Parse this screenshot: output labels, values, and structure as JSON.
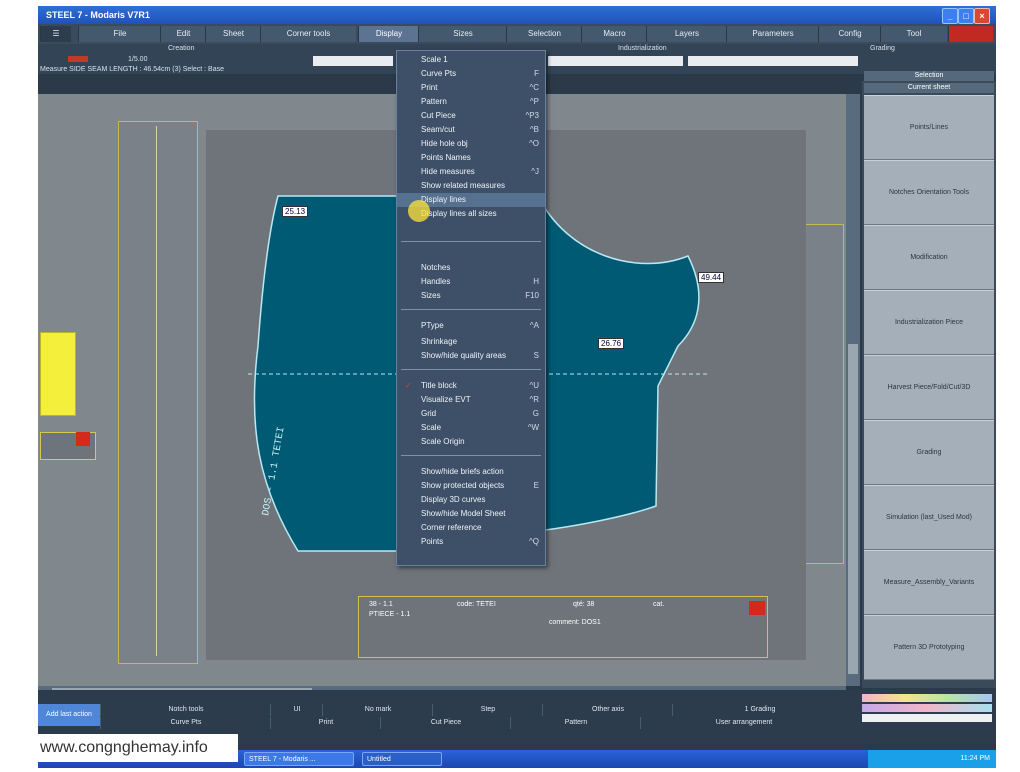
{
  "window": {
    "title": "STEEL 7 - Modaris V7R1",
    "title_short": "STEEL 7 -",
    "title_app": "Modaris V7R1"
  },
  "menubar": {
    "items": [
      "File",
      "Edit",
      "Sheet",
      "Corner tools",
      "Display",
      "Sizes",
      "Selection",
      "Macro",
      "Layers",
      "Parameters",
      "Config",
      "Tool"
    ],
    "active": "Display"
  },
  "toolbar": {
    "creation_label": "Creation",
    "indus_label": "Industrialization",
    "grading_label": "Grading",
    "scale_value": "1/5.00",
    "measure_text": "Measure SIDE SEAM LENGTH : 46.54cm (3)   Select : Base"
  },
  "display_menu": {
    "items": [
      {
        "label": "Scale 1",
        "shortcut": ""
      },
      {
        "label": "Curve Pts",
        "shortcut": "F"
      },
      {
        "label": "Print",
        "shortcut": "^C"
      },
      {
        "label": "Pattern",
        "shortcut": "^P"
      },
      {
        "label": "Cut Piece",
        "shortcut": "^P3"
      },
      {
        "label": "Seam/cut",
        "shortcut": "^B"
      },
      {
        "label": "Hide hole obj",
        "shortcut": "^O"
      },
      {
        "label": "Points Names",
        "shortcut": ""
      },
      {
        "label": "Hide measures",
        "shortcut": "^J"
      },
      {
        "label": "Show related measures",
        "shortcut": ""
      },
      {
        "label": "Display lines",
        "shortcut": ""
      },
      {
        "label": "Display lines all sizes",
        "shortcut": ""
      },
      {
        "label": "Notches",
        "shortcut": ""
      },
      {
        "label": "Handles",
        "shortcut": "H"
      },
      {
        "label": "Sizes",
        "shortcut": "F10"
      },
      {
        "label": "PType",
        "shortcut": "^A"
      },
      {
        "label": "Shrinkage",
        "shortcut": ""
      },
      {
        "label": "Show/hide quality areas",
        "shortcut": "S"
      },
      {
        "label": "Title block",
        "shortcut": "^U"
      },
      {
        "label": "Visualize EVT",
        "shortcut": "^R"
      },
      {
        "label": "Grid",
        "shortcut": "G"
      },
      {
        "label": "Scale",
        "shortcut": "^W"
      },
      {
        "label": "Scale Origin",
        "shortcut": ""
      },
      {
        "label": "Show/hide briefs action",
        "shortcut": ""
      },
      {
        "label": "Show protected objects",
        "shortcut": "E"
      },
      {
        "label": "Display 3D curves",
        "shortcut": ""
      },
      {
        "label": "Show/hide Model Sheet",
        "shortcut": ""
      },
      {
        "label": "Corner reference",
        "shortcut": ""
      },
      {
        "label": "Points",
        "shortcut": "^Q"
      }
    ]
  },
  "right_panel": {
    "selection_label": "Selection",
    "sheet_label": "Current sheet",
    "buttons": [
      "Points/Lines",
      "Notches Orientation Tools",
      "Modification",
      "Industrialization Piece",
      "Harvest Piece/Fold/Cut/3D",
      "Grading",
      "Simulation (last_Used Mod)",
      "Measure_Assembly_Variants",
      "Pattern 3D Prototyping"
    ]
  },
  "piece_labels": {
    "label1": "25.13",
    "label2": "49.44",
    "label3": "26.76",
    "label4": "38"
  },
  "title_block": {
    "line1": "38 - 1.1",
    "line2": "PTIECE - 1.1",
    "code": "code: TETEI",
    "qty": "qté: 38",
    "c": "cat.",
    "comment": "comment: DOS1"
  },
  "bottom": {
    "row1": [
      "Notch tools",
      "UI",
      "No mark",
      "Step",
      "Other axis",
      "1 Grading"
    ],
    "row2": [
      "Curve Pts",
      "Print",
      "Cut Piece",
      "Pattern",
      "User arrangement"
    ],
    "left_button": "Add last action"
  },
  "taskbar": {
    "item1": "STEEL 7 - Modaris ...",
    "item2": "Untitled",
    "clock": "11:24 PM"
  },
  "watermark": "www.congnghemay.info",
  "colors": {
    "piece_fill": "#005a74",
    "piece_outline": "#b9e8f2",
    "accent_red": "#d42a1c",
    "panel_bg": "#3a4a5b"
  }
}
